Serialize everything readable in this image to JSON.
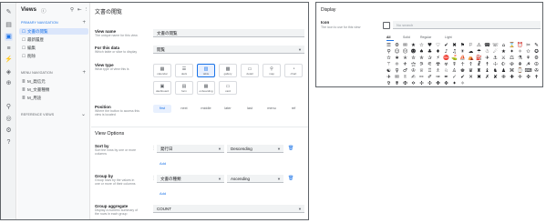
{
  "nav_rail": {
    "icons": [
      "settings-icon",
      "pages-icon",
      "views-icon",
      "data-icon",
      "actions-icon",
      "automation-icon",
      "security-icon",
      "intelligence-icon",
      "manage-icon",
      "settings-gear-icon",
      "help-icon"
    ],
    "glyphs": [
      "✎",
      "▤",
      "▣",
      "≡",
      "⚡",
      "◈",
      "⊕",
      "⚲",
      "◎",
      "⚙",
      "?"
    ]
  },
  "views_panel": {
    "title": "Views",
    "primary_label": "PRIMARY NAVIGATION",
    "primary_items": [
      {
        "label": "文書の閲覧",
        "icon": "☐"
      },
      {
        "label": "最新履歴",
        "icon": "☐"
      },
      {
        "label": "編集",
        "icon": "☐"
      },
      {
        "label": "削除",
        "icon": "☐"
      }
    ],
    "menu_label": "MENU NAVIGATION",
    "menu_items": [
      {
        "label": "M_発信元",
        "icon": "≣"
      },
      {
        "label": "M_文書種類",
        "icon": "≣"
      },
      {
        "label": "M_用途",
        "icon": "≣"
      }
    ],
    "reference_label": "REFERENCE VIEWS"
  },
  "editor": {
    "title": "文書の閲覧",
    "view_name": {
      "label": "View name",
      "hint": "The unique name for this view.",
      "value": "文書の閲覧"
    },
    "for_data": {
      "label": "For this data",
      "hint": "Which table or slice to display",
      "value": "閲覧"
    },
    "view_type": {
      "label": "View type",
      "hint": "What type of view this is",
      "options": [
        {
          "name": "calendar",
          "glyph": "▦"
        },
        {
          "name": "deck",
          "glyph": "☰"
        },
        {
          "name": "table",
          "glyph": "▥"
        },
        {
          "name": "gallery",
          "glyph": "▩"
        },
        {
          "name": "detail",
          "glyph": "▭"
        },
        {
          "name": "map",
          "glyph": "⚲"
        },
        {
          "name": "chart",
          "glyph": "◔"
        },
        {
          "name": "dashboard",
          "glyph": "▣"
        },
        {
          "name": "form",
          "glyph": "▤"
        },
        {
          "name": "onboarding",
          "glyph": "▦"
        },
        {
          "name": "card",
          "glyph": "▭"
        }
      ],
      "selected": "table"
    },
    "position": {
      "label": "Position",
      "hint": "Where the button to access this view is located",
      "options": [
        "first",
        "next",
        "middle",
        "later",
        "last",
        "menu",
        "ref"
      ],
      "selected": "first"
    },
    "view_options_title": "View Options",
    "sort_by": {
      "label": "Sort by",
      "hint": "Sort the rows by one or more columns",
      "column": "発行日",
      "order": "Descending",
      "add": "Add"
    },
    "group_by": {
      "label": "Group by",
      "hint": "Group rows by the values in one or more of their columns",
      "column": "文書の種類",
      "order": "Ascending",
      "add": "Add"
    },
    "group_aggregate": {
      "label": "Group aggregate",
      "hint": "Display a numeric summary of the rows in each group",
      "value": "COUNT"
    }
  },
  "display_panel": {
    "title": "Display",
    "icon_label": "Icon",
    "icon_hint": "The icon to use for this view",
    "search_placeholder": "No search",
    "tabs": [
      "All",
      "Solid",
      "Regular",
      "Light"
    ],
    "active_tab": "All",
    "icon_glyphs": "☰⚙✉★☆♥♡✔✖⚑⚐⚠☎☏⌂⌛⏰✂✎⚲☺☹☻♠♣♦♪♫☀☁☂☃☄★✦✧✩✪✫✬✭✮✯✰⚡⛔⛳⛵⛺⛽✈⚓⚔⚖⚗⚘⚙⚚⚛⚜⚝⚞⚟☢☣☤☥☦☧☨☩☪☫☬☭☮☯♀♂♔♕♖♗♘♙♚♛♜♝♞♟⌘⌚⌨✇✈✉✌✍✏✐✑✒✓✔✕✖✗✘✙✚✛✜✝✞✟✠✡✢✣✤✥✦✧"
  }
}
